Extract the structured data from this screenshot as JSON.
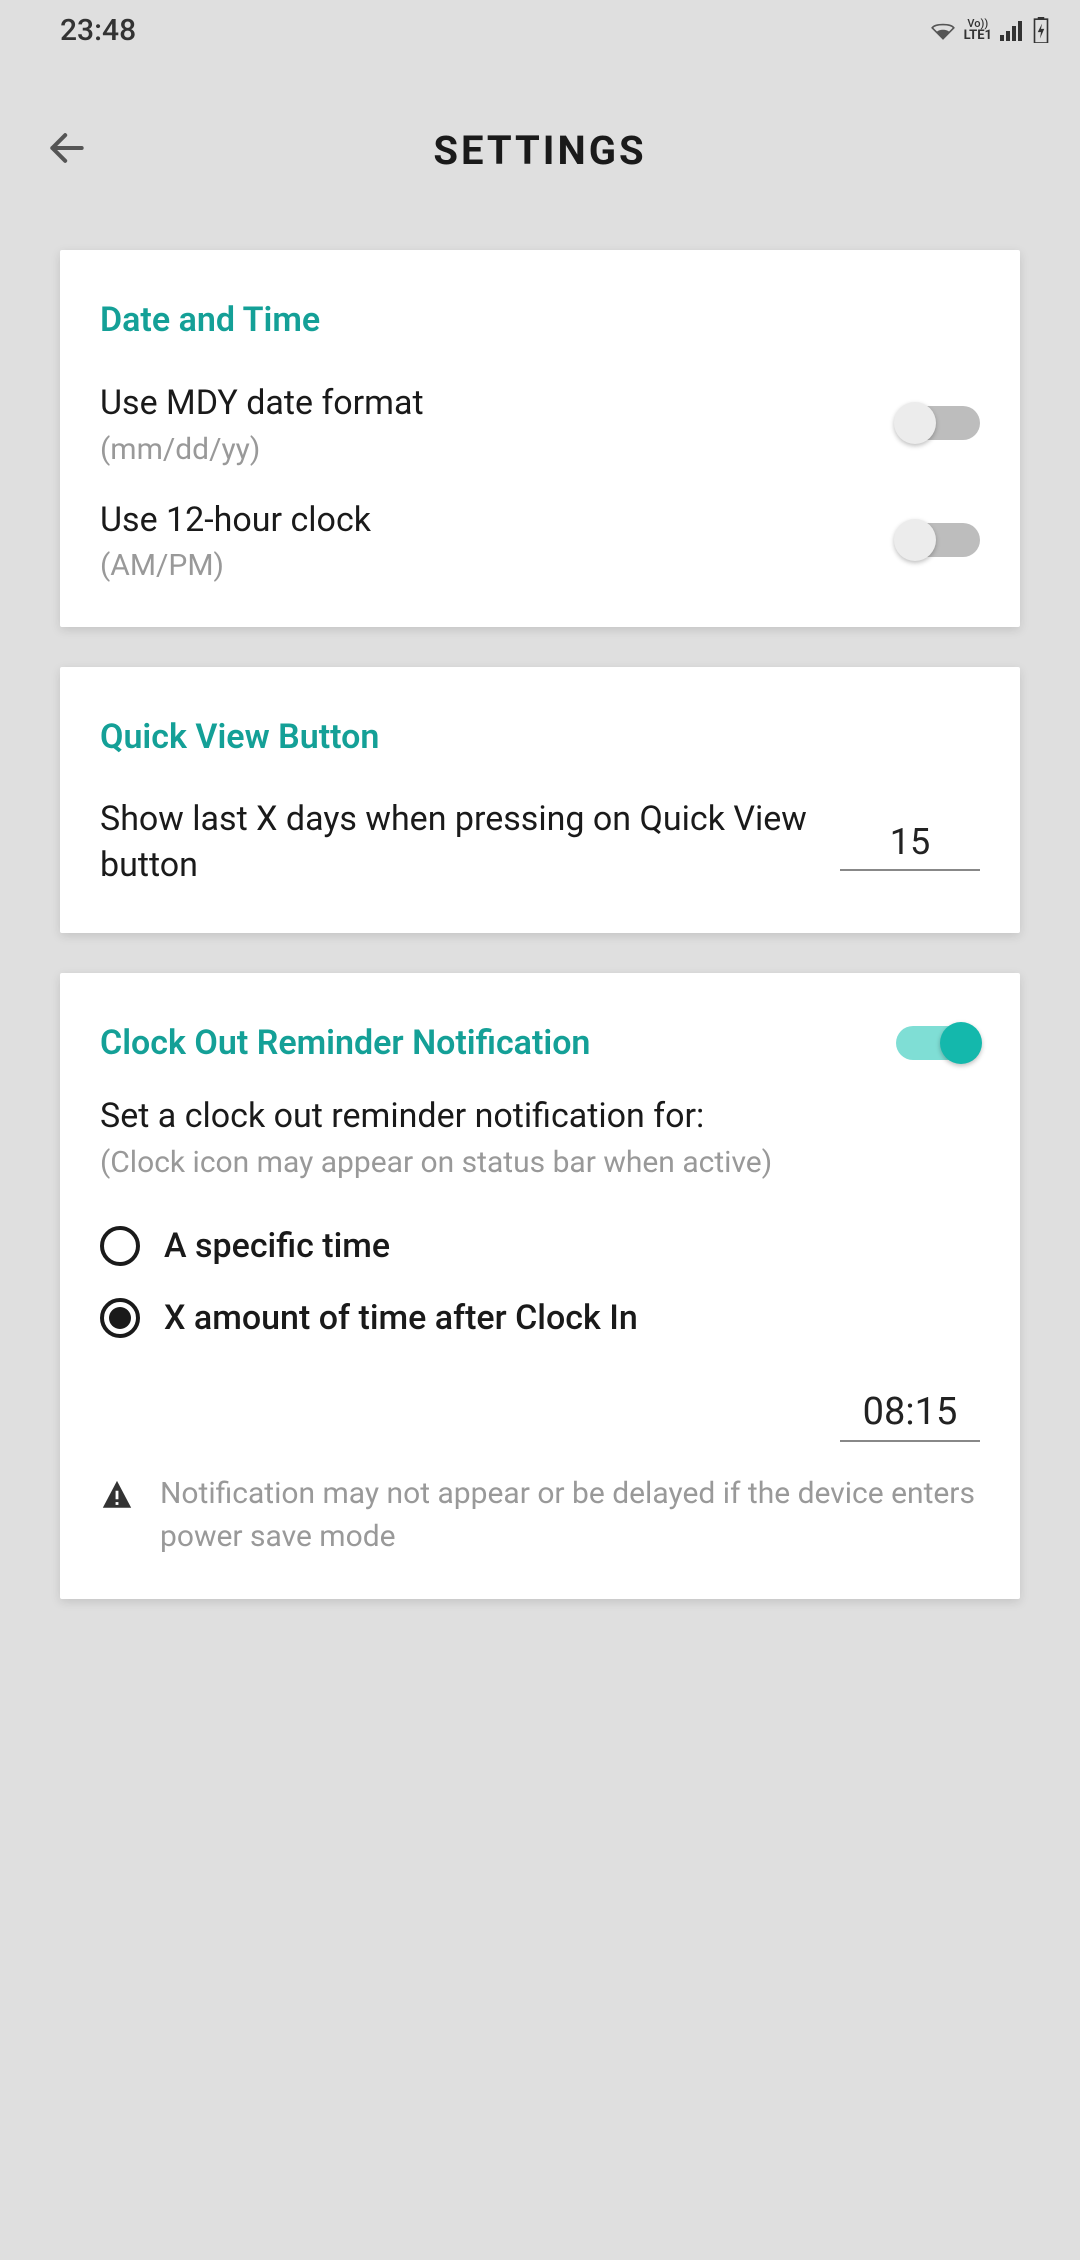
{
  "status_bar": {
    "time": "23:48",
    "network": "LTE1",
    "vo": "Vo))"
  },
  "header": {
    "title": "SETTINGS"
  },
  "sections": {
    "date_time": {
      "title": "Date and Time",
      "mdy": {
        "label": "Use MDY date format",
        "sub": "(mm/dd/yy)",
        "on": false
      },
      "clock12": {
        "label": "Use 12-hour clock",
        "sub": "(AM/PM)",
        "on": false
      }
    },
    "quick_view": {
      "title": "Quick View Button",
      "days_label": "Show last X days when pressing on Quick View button",
      "days_value": "15"
    },
    "clock_out": {
      "title": "Clock Out Reminder Notification",
      "on": true,
      "label": "Set a clock out reminder notification for:",
      "sub": "(Clock icon may appear on status bar when active)",
      "options": {
        "specific": {
          "label": "A specific time",
          "selected": false
        },
        "after": {
          "label": "X amount of time after Clock In",
          "selected": true
        }
      },
      "time_value": "08:15",
      "warning": "Notification may not appear or be delayed if the device enters power save mode"
    }
  }
}
